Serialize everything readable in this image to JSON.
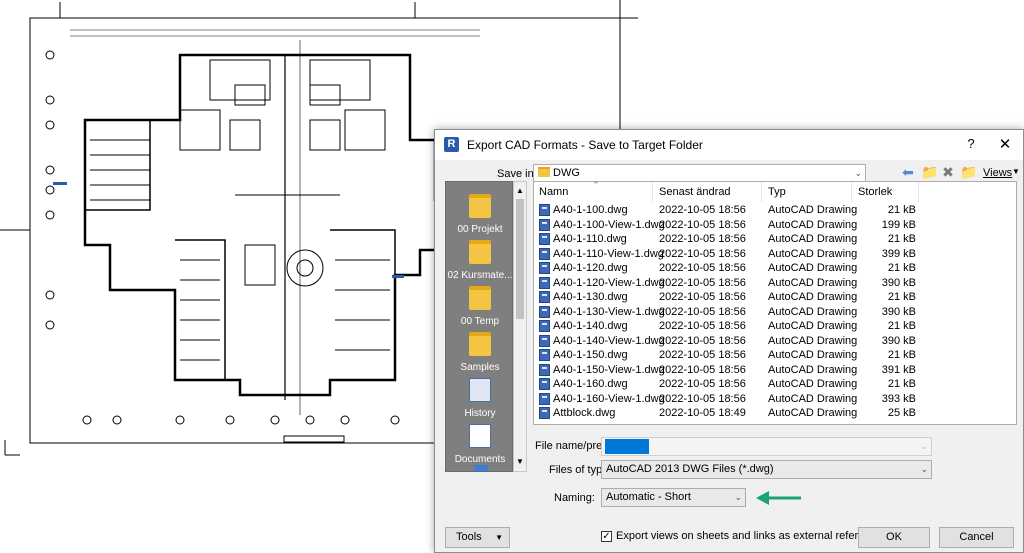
{
  "dialog": {
    "title": "Export CAD Formats - Save to Target Folder",
    "app_icon_letter": "R",
    "help_label": "?",
    "close_label": "✕"
  },
  "save_in": {
    "label": "Save in:",
    "value": "DWG",
    "views_label": "Views"
  },
  "places": [
    {
      "label": "00 Projekt",
      "icon": "folder-icon"
    },
    {
      "label": "02 Kursmate...",
      "icon": "folder-icon"
    },
    {
      "label": "00 Temp",
      "icon": "folder-icon"
    },
    {
      "label": "Samples",
      "icon": "folder-icon"
    },
    {
      "label": "History",
      "icon": "history-icon"
    },
    {
      "label": "Documents",
      "icon": "documents-icon"
    }
  ],
  "columns": {
    "name": "Namn",
    "date": "Senast ändrad",
    "type": "Typ",
    "size": "Storlek"
  },
  "files": [
    {
      "name": "A40-1-100.dwg",
      "date": "2022-10-05 18:56",
      "type": "AutoCAD Drawing",
      "size": "21 kB"
    },
    {
      "name": "A40-1-100-View-1.dwg",
      "date": "2022-10-05 18:56",
      "type": "AutoCAD Drawing",
      "size": "199 kB"
    },
    {
      "name": "A40-1-110.dwg",
      "date": "2022-10-05 18:56",
      "type": "AutoCAD Drawing",
      "size": "21 kB"
    },
    {
      "name": "A40-1-110-View-1.dwg",
      "date": "2022-10-05 18:56",
      "type": "AutoCAD Drawing",
      "size": "399 kB"
    },
    {
      "name": "A40-1-120.dwg",
      "date": "2022-10-05 18:56",
      "type": "AutoCAD Drawing",
      "size": "21 kB"
    },
    {
      "name": "A40-1-120-View-1.dwg",
      "date": "2022-10-05 18:56",
      "type": "AutoCAD Drawing",
      "size": "390 kB"
    },
    {
      "name": "A40-1-130.dwg",
      "date": "2022-10-05 18:56",
      "type": "AutoCAD Drawing",
      "size": "21 kB"
    },
    {
      "name": "A40-1-130-View-1.dwg",
      "date": "2022-10-05 18:56",
      "type": "AutoCAD Drawing",
      "size": "390 kB"
    },
    {
      "name": "A40-1-140.dwg",
      "date": "2022-10-05 18:56",
      "type": "AutoCAD Drawing",
      "size": "21 kB"
    },
    {
      "name": "A40-1-140-View-1.dwg",
      "date": "2022-10-05 18:56",
      "type": "AutoCAD Drawing",
      "size": "390 kB"
    },
    {
      "name": "A40-1-150.dwg",
      "date": "2022-10-05 18:56",
      "type": "AutoCAD Drawing",
      "size": "21 kB"
    },
    {
      "name": "A40-1-150-View-1.dwg",
      "date": "2022-10-05 18:56",
      "type": "AutoCAD Drawing",
      "size": "391 kB"
    },
    {
      "name": "A40-1-160.dwg",
      "date": "2022-10-05 18:56",
      "type": "AutoCAD Drawing",
      "size": "21 kB"
    },
    {
      "name": "A40-1-160-View-1.dwg",
      "date": "2022-10-05 18:56",
      "type": "AutoCAD Drawing",
      "size": "393 kB"
    },
    {
      "name": "Attblock.dwg",
      "date": "2022-10-05 18:49",
      "type": "AutoCAD Drawing",
      "size": "25 kB"
    }
  ],
  "file_name": {
    "label": "File name/prefix:",
    "value": ""
  },
  "files_of_type": {
    "label": "Files of type:",
    "value": "AutoCAD 2013 DWG Files  (*.dwg)"
  },
  "naming": {
    "label": "Naming:",
    "value": "Automatic - Short"
  },
  "buttons": {
    "tools": "Tools",
    "ok": "OK",
    "cancel": "Cancel"
  },
  "export_views": {
    "label": "Export views on sheets and links as external references",
    "checked": true
  },
  "colors": {
    "selection": "#0078d7",
    "arrow": "#1aa37a"
  }
}
